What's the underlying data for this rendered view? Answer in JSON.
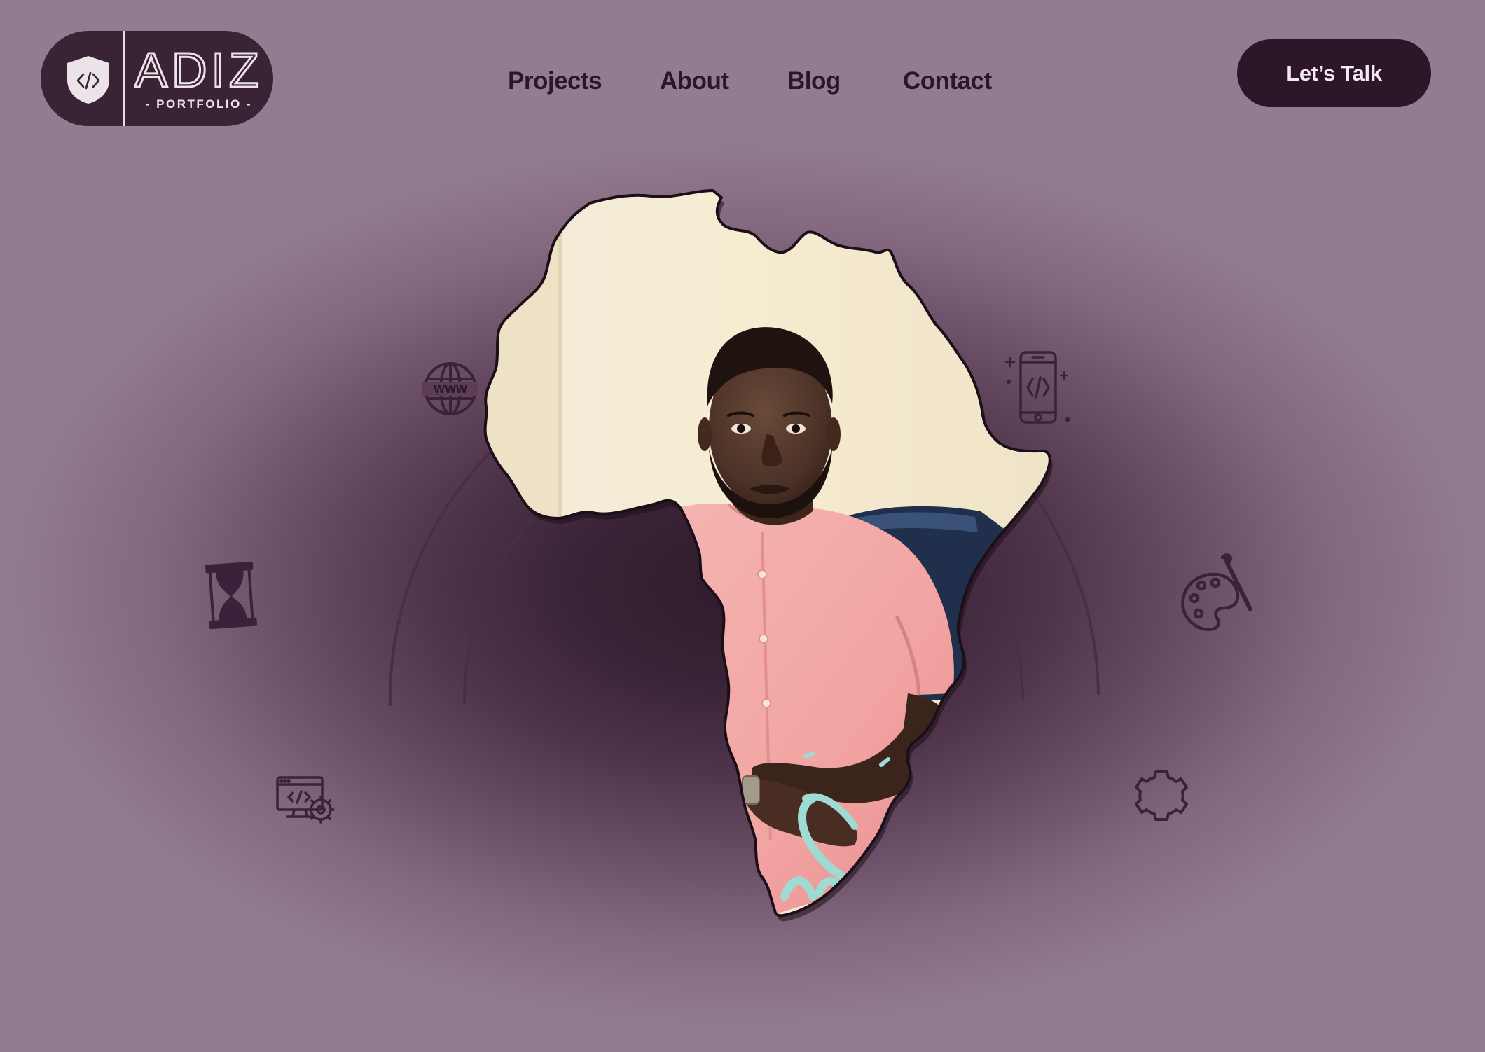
{
  "brand": {
    "name": "ADIZ",
    "tagline": "- PORTFOLIO -",
    "logo_icon": "code-shield-icon"
  },
  "nav": {
    "items": [
      {
        "label": "Projects"
      },
      {
        "label": "About"
      },
      {
        "label": "Blog"
      },
      {
        "label": "Contact"
      }
    ]
  },
  "cta": {
    "label": "Let’s Talk"
  },
  "hero": {
    "portrait_shape": "africa-map",
    "orbit_icons": [
      "www-globe-icon",
      "mobile-code-icon",
      "hourglass-icon",
      "palette-brush-icon",
      "monitor-code-gear-icon",
      "puzzle-gear-icon"
    ]
  },
  "colors": {
    "background": "#937c91",
    "background_center": "#2e1b2b",
    "accent_dark": "#2d1627",
    "icon_stroke": "#3d2039",
    "shirt": "#f2a8a6",
    "wall": "#f4ead2"
  }
}
